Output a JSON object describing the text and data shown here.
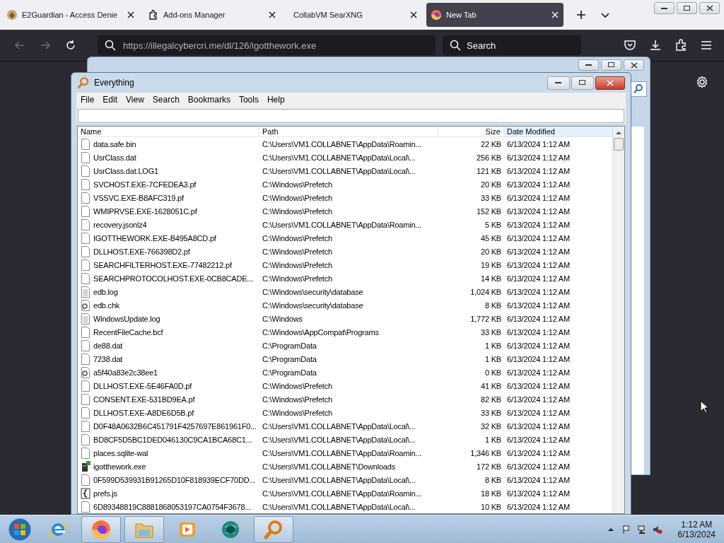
{
  "browser": {
    "tabs": [
      {
        "label": "E2Guardian - Access Denie",
        "kind": "guardian",
        "selected": false
      },
      {
        "label": "Add-ons Manager",
        "kind": "addons",
        "selected": false
      },
      {
        "label": "CollabVM SearXNG",
        "kind": "none",
        "selected": false
      },
      {
        "label": "New Tab",
        "kind": "firefox",
        "selected": true
      }
    ],
    "url": "https://illegalcybercri.me/dl/126/igotthework.exe",
    "search_placeholder": "Search"
  },
  "everything": {
    "title": "Everything",
    "menu": [
      "File",
      "Edit",
      "View",
      "Search",
      "Bookmarks",
      "Tools",
      "Help"
    ],
    "columns": [
      "Name",
      "Path",
      "Size",
      "Date Modified"
    ],
    "rows": [
      {
        "kind": "doc",
        "name": "data.safe.bin",
        "path": "C:\\Users\\VM1.COLLABNET\\AppData\\Roamin...",
        "size": "22 KB",
        "date": "6/13/2024 1:12 AM"
      },
      {
        "kind": "doc",
        "name": "UsrClass.dat",
        "path": "C:\\Users\\VM1.COLLABNET\\AppData\\Local\\...",
        "size": "256 KB",
        "date": "6/13/2024 1:12 AM"
      },
      {
        "kind": "doc",
        "name": "UsrClass.dat.LOG1",
        "path": "C:\\Users\\VM1.COLLABNET\\AppData\\Local\\...",
        "size": "121 KB",
        "date": "6/13/2024 1:12 AM"
      },
      {
        "kind": "doc",
        "name": "SVCHOST.EXE-7CFEDEA3.pf",
        "path": "C:\\Windows\\Prefetch",
        "size": "20 KB",
        "date": "6/13/2024 1:12 AM"
      },
      {
        "kind": "doc",
        "name": "VSSVC.EXE-B8AFC319.pf",
        "path": "C:\\Windows\\Prefetch",
        "size": "33 KB",
        "date": "6/13/2024 1:12 AM"
      },
      {
        "kind": "doc",
        "name": "WMIPRVSE.EXE-1628051C.pf",
        "path": "C:\\Windows\\Prefetch",
        "size": "152 KB",
        "date": "6/13/2024 1:12 AM"
      },
      {
        "kind": "doc",
        "name": "recovery.jsonlz4",
        "path": "C:\\Users\\VM1.COLLABNET\\AppData\\Roamin...",
        "size": "5 KB",
        "date": "6/13/2024 1:12 AM"
      },
      {
        "kind": "doc",
        "name": "IGOTTHEWORK.EXE-B495A8CD.pf",
        "path": "C:\\Windows\\Prefetch",
        "size": "45 KB",
        "date": "6/13/2024 1:12 AM"
      },
      {
        "kind": "doc",
        "name": "DLLHOST.EXE-766398D2.pf",
        "path": "C:\\Windows\\Prefetch",
        "size": "20 KB",
        "date": "6/13/2024 1:12 AM"
      },
      {
        "kind": "doc",
        "name": "SEARCHFILTERHOST.EXE-77482212.pf",
        "path": "C:\\Windows\\Prefetch",
        "size": "19 KB",
        "date": "6/13/2024 1:12 AM"
      },
      {
        "kind": "doc",
        "name": "SEARCHPROTOCOLHOST.EXE-0CB8CADE...",
        "path": "C:\\Windows\\Prefetch",
        "size": "14 KB",
        "date": "6/13/2024 1:12 AM"
      },
      {
        "kind": "text",
        "name": "edb.log",
        "path": "C:\\Windows\\security\\database",
        "size": "1,024 KB",
        "date": "6/13/2024 1:12 AM"
      },
      {
        "kind": "link",
        "name": "edb.chk",
        "path": "C:\\Windows\\security\\database",
        "size": "8 KB",
        "date": "6/13/2024 1:12 AM"
      },
      {
        "kind": "text",
        "name": "WindowsUpdate.log",
        "path": "C:\\Windows",
        "size": "1,772 KB",
        "date": "6/13/2024 1:12 AM"
      },
      {
        "kind": "doc",
        "name": "RecentFileCache.bcf",
        "path": "C:\\Windows\\AppCompat\\Programs",
        "size": "33 KB",
        "date": "6/13/2024 1:12 AM"
      },
      {
        "kind": "doc",
        "name": "de88.dat",
        "path": "C:\\ProgramData",
        "size": "1 KB",
        "date": "6/13/2024 1:12 AM"
      },
      {
        "kind": "doc",
        "name": "7238.dat",
        "path": "C:\\ProgramData",
        "size": "1 KB",
        "date": "6/13/2024 1:12 AM"
      },
      {
        "kind": "link",
        "name": "a5f40a83e2c38ee1",
        "path": "C:\\ProgramData",
        "size": "0 KB",
        "date": "6/13/2024 1:12 AM"
      },
      {
        "kind": "doc",
        "name": "DLLHOST.EXE-5E46FA0D.pf",
        "path": "C:\\Windows\\Prefetch",
        "size": "41 KB",
        "date": "6/13/2024 1:12 AM"
      },
      {
        "kind": "doc",
        "name": "CONSENT.EXE-531BD9EA.pf",
        "path": "C:\\Windows\\Prefetch",
        "size": "82 KB",
        "date": "6/13/2024 1:12 AM"
      },
      {
        "kind": "doc",
        "name": "DLLHOST.EXE-A8DE6D5B.pf",
        "path": "C:\\Windows\\Prefetch",
        "size": "33 KB",
        "date": "6/13/2024 1:12 AM"
      },
      {
        "kind": "doc",
        "name": "D0F48A0632B6C451791F4257697E861961F0...",
        "path": "C:\\Users\\VM1.COLLABNET\\AppData\\Local\\...",
        "size": "32 KB",
        "date": "6/13/2024 1:12 AM"
      },
      {
        "kind": "doc",
        "name": "BD8CF5D5BC1DED046130C9CA1BCA68C1...",
        "path": "C:\\Users\\VM1.COLLABNET\\AppData\\Local\\...",
        "size": "1 KB",
        "date": "6/13/2024 1:12 AM"
      },
      {
        "kind": "doc",
        "name": "places.sqlite-wal",
        "path": "C:\\Users\\VM1.COLLABNET\\AppData\\Roamin...",
        "size": "1,346 KB",
        "date": "6/13/2024 1:12 AM"
      },
      {
        "kind": "exe",
        "name": "igotthework.exe",
        "path": "C:\\Users\\VM1.COLLABNET\\Downloads",
        "size": "172 KB",
        "date": "6/13/2024 1:12 AM"
      },
      {
        "kind": "doc",
        "name": "0F599D539931B91265D10F818939ECF70DD...",
        "path": "C:\\Users\\VM1.COLLABNET\\AppData\\Local\\...",
        "size": "8 KB",
        "date": "6/13/2024 1:12 AM"
      },
      {
        "kind": "script",
        "name": "prefs.js",
        "path": "C:\\Users\\VM1.COLLABNET\\AppData\\Roamin...",
        "size": "18 KB",
        "date": "6/13/2024 1:12 AM"
      },
      {
        "kind": "doc",
        "name": "6D89348819C8881868053197CA0754F3678...",
        "path": "C:\\Users\\VM1.COLLABNET\\AppData\\Local\\...",
        "size": "10 KB",
        "date": "6/13/2024 1:12 AM"
      }
    ]
  },
  "taskbar": {
    "items": [
      {
        "kind": "ie",
        "running": false
      },
      {
        "kind": "firefox",
        "running": true
      },
      {
        "kind": "explorer",
        "running": true
      },
      {
        "kind": "media",
        "running": false
      },
      {
        "kind": "globe",
        "running": false
      },
      {
        "kind": "everything",
        "running": true
      }
    ],
    "time": "1:12 AM",
    "date": "6/13/2024"
  }
}
